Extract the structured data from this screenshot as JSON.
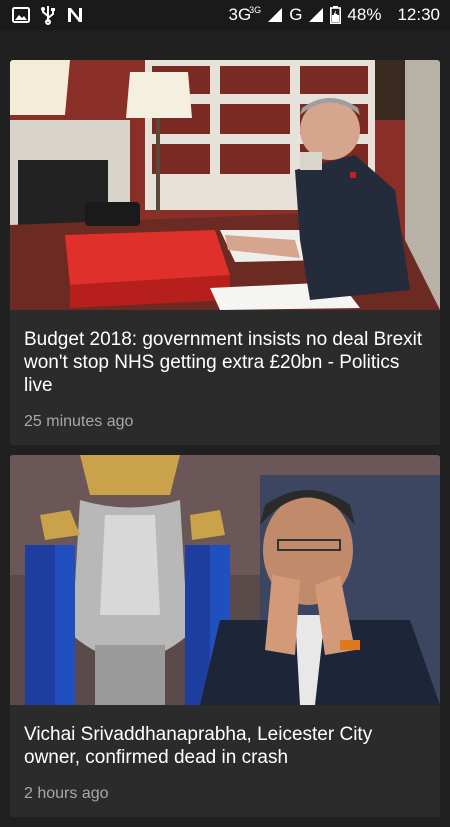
{
  "status_bar": {
    "icons_left": [
      "image-icon",
      "usb-icon",
      "n-app-icon"
    ],
    "network_3g": "3G",
    "network_3g_sup": "3G",
    "network_g": "G",
    "battery_percent": "48%",
    "time": "12:30"
  },
  "articles": [
    {
      "title": "Budget 2018: government insists no deal Brexit won't stop NHS getting extra £20bn - Politics live",
      "time": "25 minutes ago",
      "image": "man-at-desk-with-red-budget-box"
    },
    {
      "title": "Vichai Srivaddhanaprabha, Leicester City owner, confirmed dead in crash",
      "time": "2 hours ago",
      "image": "man-applauding-beside-premier-league-trophy"
    }
  ]
}
